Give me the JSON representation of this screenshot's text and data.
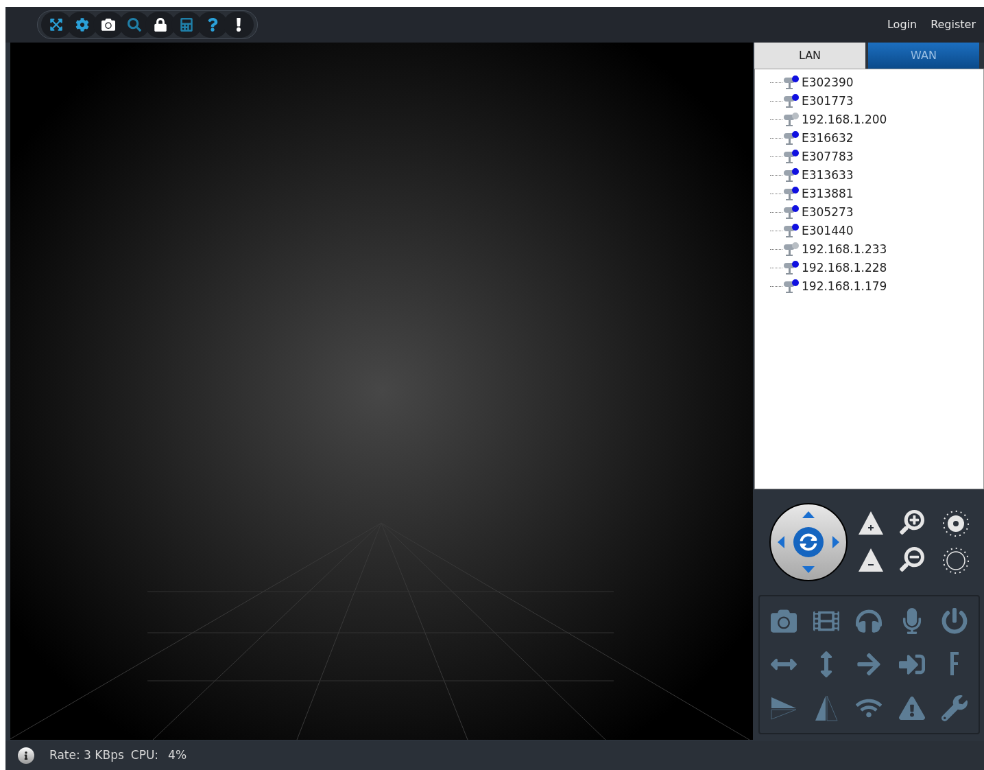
{
  "top_bar": {
    "links": [
      "Login",
      "Register"
    ]
  },
  "device_panel": {
    "tabs": [
      {
        "label": "LAN",
        "selected": true
      },
      {
        "label": "WAN",
        "selected": false
      }
    ],
    "devices": [
      {
        "name": "E302390",
        "online": true
      },
      {
        "name": "E301773",
        "online": true
      },
      {
        "name": "192.168.1.200",
        "online": false
      },
      {
        "name": "E316632",
        "online": true
      },
      {
        "name": "E307783",
        "online": true
      },
      {
        "name": "E313633",
        "online": true
      },
      {
        "name": "E313881",
        "online": true
      },
      {
        "name": "E305273",
        "online": true
      },
      {
        "name": "E301440",
        "online": true
      },
      {
        "name": "192.168.1.233",
        "online": false
      },
      {
        "name": "192.168.1.228",
        "online": true
      },
      {
        "name": "192.168.1.179",
        "online": true
      }
    ]
  },
  "status_bar": {
    "rate": "Rate: 3 KBps",
    "cpu_label": "CPU:",
    "cpu": "4%"
  }
}
